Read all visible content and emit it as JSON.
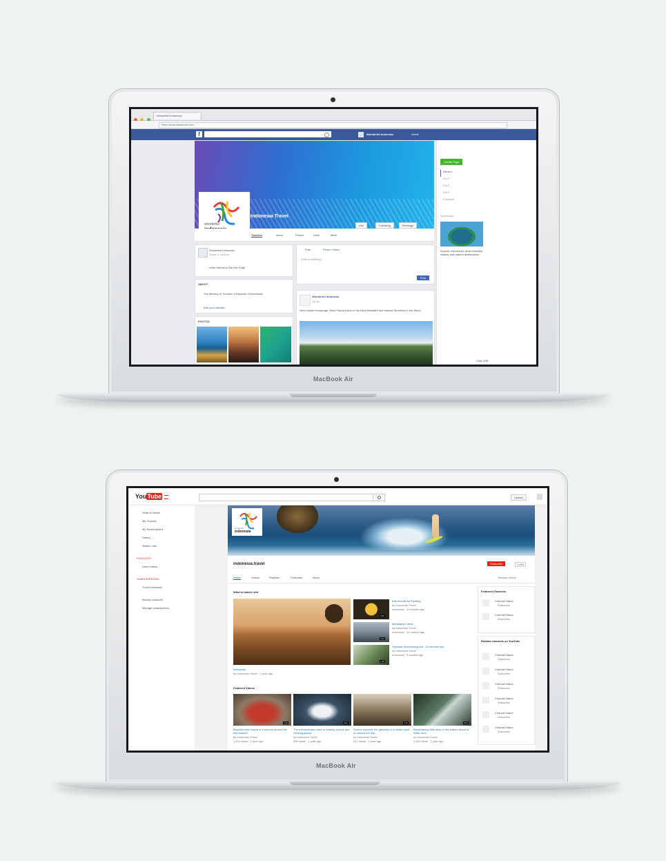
{
  "laptop_top": {
    "brand": "MacBook Air"
  },
  "laptop_bottom": {
    "brand": "MacBook Air"
  },
  "facebook": {
    "browser_tab": "Wonderful Indonesia",
    "url": "https://www.facebook.com/",
    "search_placeholder": "",
    "header_page_name": "Wonderful Indonesia",
    "header_home": "Home",
    "page_title": "Indonesia Travel",
    "logo_word": "wonderful",
    "logo_country": "indonesia",
    "buttons": {
      "like": "Like",
      "message": "Message",
      "follow": "Following"
    },
    "tabs": [
      "Timeline",
      "About",
      "Photos",
      "Likes",
      "More"
    ],
    "left_card_title": "Wonderful Indonesia",
    "left_card_sub": "Travel & Leisure",
    "left_card_action": "Invite friends to like this Page",
    "about_title": "ABOUT",
    "about_text": "The Ministry of Tourism of Republic of Indonesia",
    "about_link": "Add your website",
    "photos_title": "PHOTOS",
    "compose_status": "Post",
    "compose_photo": "Photo / Video",
    "compose_placeholder": "Write something...",
    "compose_button": "Post",
    "post_author": "Wonderful Indonesia",
    "post_time": "16 hrs",
    "post_text": "New Instant homepage: West Papua travel to the Most Beautiful and Natural Shoreline in the World",
    "sidebar_button": "Create Page",
    "sidebar_items": [
      "Recent",
      "2015",
      "2014",
      "2013",
      "Founded"
    ],
    "sidebar_label": "Sponsored",
    "sidebar_ad_text": "Explore Indonesia's most beautiful islands and natural destinations",
    "chat": "Chat (Off)"
  },
  "youtube": {
    "logo_you": "You",
    "logo_tube": "Tube",
    "upload": "Upload",
    "sidebar": [
      "What to Watch",
      "My Channel",
      "My Subscriptions",
      "History",
      "Watch Later"
    ],
    "playlists_title": "PLAYLISTS",
    "playlists": [
      "Liked videos"
    ],
    "subs_title": "SUBSCRIPTIONS",
    "subs": [
      "Travel Indonesia"
    ],
    "extras": [
      "Browse channels",
      "Manage subscriptions"
    ],
    "logo_word": "wonderful",
    "logo_country": "indonesia",
    "channel_name": "indonesia.travel",
    "subscribe": "Subscribe",
    "sub_count": "1,234",
    "tabs": [
      "Home",
      "Videos",
      "Playlists",
      "Channels",
      "About"
    ],
    "browse": "Browse videos",
    "section_watch": "What to watch next",
    "main_video_title": "Wonderful",
    "main_video_meta": "by Indonesia Travel · 1 year ago",
    "side_videos": [
      {
        "title": "Bali Wonderful Painting",
        "meta": "by Indonesia Travel",
        "views": "Indonesia · 11 months ago",
        "time": "3:25"
      },
      {
        "title": "Mahakarya Jawa",
        "meta": "by Indonesia Travel",
        "views": "Indonesia · 10 months ago",
        "time": "4:12"
      },
      {
        "title": "Sarawak Indonesia guide - 20 minutes tips",
        "meta": "by Indonesia Travel",
        "views": "Indonesia · 9 months ago",
        "time": "2:48"
      }
    ],
    "section_featured": "Featured Videos",
    "featured": [
      {
        "title": "Beautiful wild Vespa of a journey around the Bali Islands",
        "meta": "by Indonesia Travel",
        "views": "1,204 views · 1 year ago",
        "time": "3:36"
      },
      {
        "title": "The extraordinary route of reading a book and relaxing places",
        "meta": "by Indonesia Travel",
        "views": "954 views · 1 year ago",
        "time": "4:01"
      },
      {
        "title": "Soothe yourself: the getaway to a hidden spot to unwind the day",
        "meta": "by Indonesia Travel",
        "views": "812 views · 1 year ago",
        "time": "2:15"
      },
      {
        "title": "Breathtaking falls deep in the hidden forest of West Java",
        "meta": "by Indonesia Travel",
        "views": "1,020 views · 1 year ago",
        "time": "5:04"
      }
    ],
    "right_title_1": "Featured Channels",
    "right_title_2": "Related channels on YouTube",
    "channel_item": "Channel Name",
    "channel_sub": "Subscribe"
  }
}
